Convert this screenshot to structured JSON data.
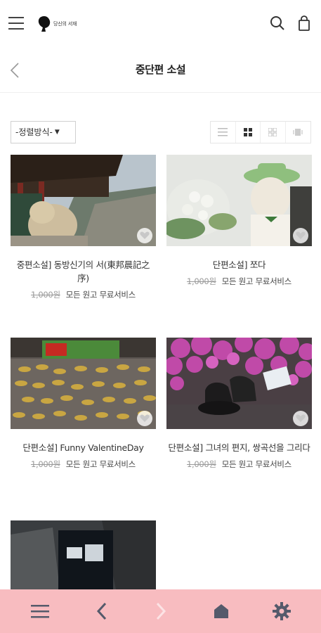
{
  "header": {
    "menu_icon": "hamburger-icon",
    "logo_text": "당신의 서재",
    "search_icon": "search-icon",
    "cart_icon": "shopping-bag-icon"
  },
  "category": {
    "title": "중단편 소설",
    "back_icon": "chevron-left-icon"
  },
  "toolbar": {
    "sort_label": "-정렬방식-",
    "view_modes": [
      "list-view-icon",
      "grid-2-view-icon",
      "grid-4-view-icon",
      "gallery-view-icon"
    ],
    "active_view": "grid-2-view-icon"
  },
  "products": [
    {
      "name": "중편소설] 동방신기의 서(東邦晨記之 序)",
      "old_price": "1,000원",
      "service": "모든 원고 무료서비스"
    },
    {
      "name": "단편소설] 쪼다",
      "old_price": "1,000원",
      "service": "모든 원고 무료서비스"
    },
    {
      "name": "단편소설] Funny ValentineDay",
      "old_price": "1,000원",
      "service": "모든 원고 무료서비스"
    },
    {
      "name": "단편소설] 그녀의 편지, 쌍곡선을 그리다",
      "old_price": "1,000원",
      "service": "모든 원고 무료서비스"
    },
    {
      "name": "",
      "old_price": "",
      "service": ""
    }
  ],
  "bottom_nav": {
    "items": [
      "menu-icon",
      "back-icon",
      "forward-icon",
      "home-icon",
      "settings-icon"
    ],
    "background": "#f8bcc0"
  }
}
